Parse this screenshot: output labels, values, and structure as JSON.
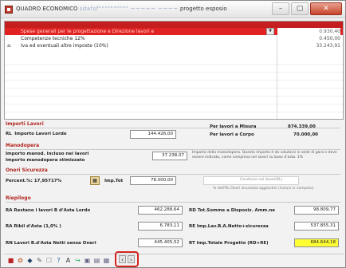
{
  "window": {
    "title_prefix": "QUADRO ECONOMICO",
    "title_obscured": "sdafsf\"\"\"\"\"\"\"\"\"\" ~~~~~ ~~~~",
    "title_suffix": "progetto esposio",
    "min_glyph": "–",
    "max_glyph": "▢",
    "close_glyph": "✕"
  },
  "grid": {
    "rows": [
      {
        "marker": "",
        "label": "Spese generali per le progettazione e Direzione lavori e",
        "value": "0.930,40",
        "selected": true
      },
      {
        "marker": "",
        "label": "Competenze tecniche 12%",
        "value": "0.450,00",
        "selected": false
      },
      {
        "marker": "a:",
        "label": "Iva ed eventuali altre imposte (10%)",
        "value": "33.243,91",
        "selected": false
      }
    ]
  },
  "importi_lavori": {
    "title": "Importi Lavori",
    "lordo_prefix": "RL",
    "lordo_label": "Importo Lavori Lordo",
    "lordo_value": "144.426,00",
    "misura_label": "Per lavori a Misura",
    "misura_value": "874.339,00",
    "corpo_label": "Per lavori a Corpo",
    "corpo_value": "70.000,00"
  },
  "manodopera": {
    "title": "Manodopera",
    "label_line1": "Importo manod. incluso nei lavori",
    "label_line2": "Importo manodopera stimizzato",
    "value": "37.238,07",
    "note": "Importo della manodopera. Questo importo è da valutarsi in sede di gara e deve essere indicato, come compresa nei lavori su base d'asta. 1%"
  },
  "oneri_sicurezza": {
    "title": "Oneri Sicurezza",
    "percent_label": "Percent.%: 17,95717%",
    "imp_label": "Imp.Tot",
    "imp_value": "78.000,00",
    "right_label": "Condiviso nei lavori(RL)",
    "right_hint": "% dell'RL  Oneri sicurezza aggiuntivi (inclusi in computo)"
  },
  "riepilogo": {
    "title": "Riepilogo",
    "rows": [
      {
        "label": "RA  Restano i lavori B d'Asta Lordo",
        "value": "462.288,64",
        "right_label": "RD  Tot.Somme a Disposiz. Amm.ne",
        "right_value": "98.809,77",
        "right_yellow": false
      },
      {
        "label": "RA  Ribil d'Asta  (1,0% )",
        "value": "6.783,11",
        "right_label": "RE  Imp.Lav.B.A.Netto+sicurezza",
        "right_value": "537.855,31",
        "right_yellow": false
      },
      {
        "label": "RN  Lavori B.d'Asta Netti senza Oneri",
        "value": "445.405,52",
        "right_label": "RT  Imp.Totale Progetto (RD+RE)",
        "right_value": "684.644,18",
        "right_yellow": true
      }
    ]
  },
  "toolbar": {
    "icons": [
      "■",
      "✿",
      "◆",
      "✎",
      "☐",
      "?",
      "A",
      "↪",
      "▣",
      "▤",
      "▦"
    ],
    "nav_prev": "‹",
    "nav_next": "›"
  }
}
